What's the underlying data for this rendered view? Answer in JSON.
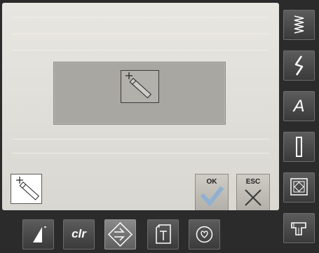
{
  "screen": {
    "title": "",
    "colors": {
      "panel_bg": "#dedcd6",
      "work_field": "#a9a7a2",
      "toolbar_bg": "#2b2b2b",
      "button_dark": "#4a4a4a",
      "ok_check": "#8fb0d0",
      "esc_cross": "#3a3a3a"
    }
  },
  "main": {
    "work_field_icon": "pencil-crosshair-icon",
    "mode_button_icon": "pencil-crosshair-icon"
  },
  "dialog": {
    "ok_label": "OK",
    "esc_label": "ESC"
  },
  "sidebar": {
    "items": [
      {
        "icon": "zigzag-stitch-icon"
      },
      {
        "icon": "decorative-stitch-icon"
      },
      {
        "icon": "alphabet-icon",
        "label": "A"
      },
      {
        "icon": "buttonhole-icon"
      },
      {
        "icon": "quilt-icon"
      },
      {
        "icon": "setup-icon"
      }
    ]
  },
  "toolbar": {
    "items": [
      {
        "icon": "stitch-length-icon"
      },
      {
        "icon": "clear-icon",
        "label": "clr"
      },
      {
        "icon": "direction-arrow-icon",
        "active": true
      },
      {
        "icon": "tutorial-icon"
      },
      {
        "icon": "favorites-heart-icon"
      }
    ]
  }
}
